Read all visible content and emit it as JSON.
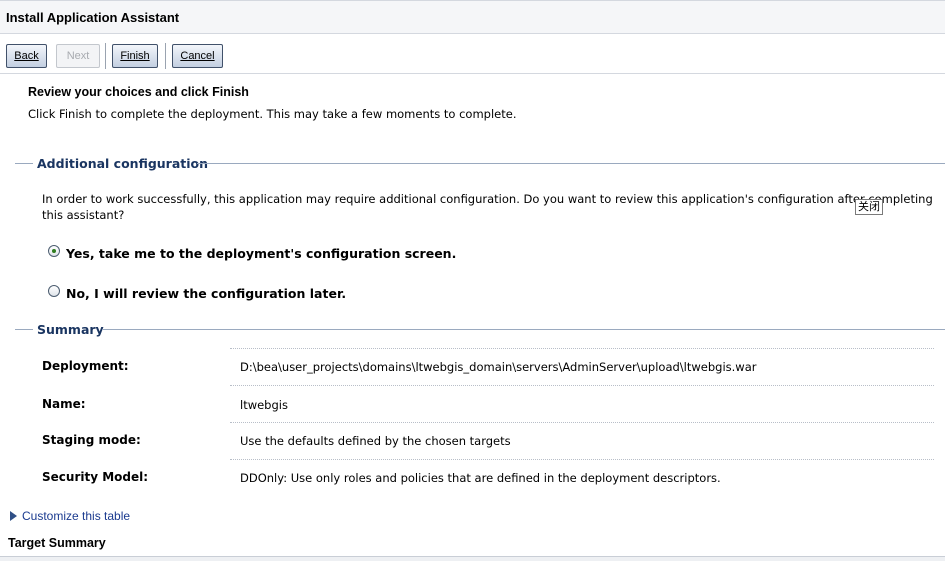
{
  "app": {
    "title": "Install Application Assistant"
  },
  "toolbar": {
    "back_label": "Back",
    "next_label": "Next",
    "finish_label": "Finish",
    "cancel_label": "Cancel"
  },
  "intro": {
    "heading": "Review your choices and click Finish",
    "instruction": "Click Finish to complete the deployment. This may take a few moments to complete."
  },
  "additional_config": {
    "title": "Additional configuration",
    "text": "In order to work successfully, this application may require additional configuration. Do you want to review this application's configuration after completing this assistant?",
    "options": [
      {
        "label": "Yes, take me to the deployment's configuration screen.",
        "selected": true
      },
      {
        "label": "No, I will review the configuration later.",
        "selected": false
      }
    ]
  },
  "tooltip": {
    "text": "关闭"
  },
  "summary": {
    "title": "Summary",
    "rows": [
      {
        "label": "Deployment:",
        "value": "D:\\bea\\user_projects\\domains\\ltwebgis_domain\\servers\\AdminServer\\upload\\ltwebgis.war"
      },
      {
        "label": "Name:",
        "value": "ltwebgis"
      },
      {
        "label": "Staging mode:",
        "value": "Use the defaults defined by the chosen targets"
      },
      {
        "label": "Security Model:",
        "value": "DDOnly: Use only roles and policies that are defined in the deployment descriptors."
      }
    ]
  },
  "customize_link": "Customize this table",
  "target_summary": {
    "title": "Target Summary"
  },
  "colors": {
    "section_title": "#1a3561",
    "link": "#1a3a8f",
    "accent": "#41516a"
  }
}
